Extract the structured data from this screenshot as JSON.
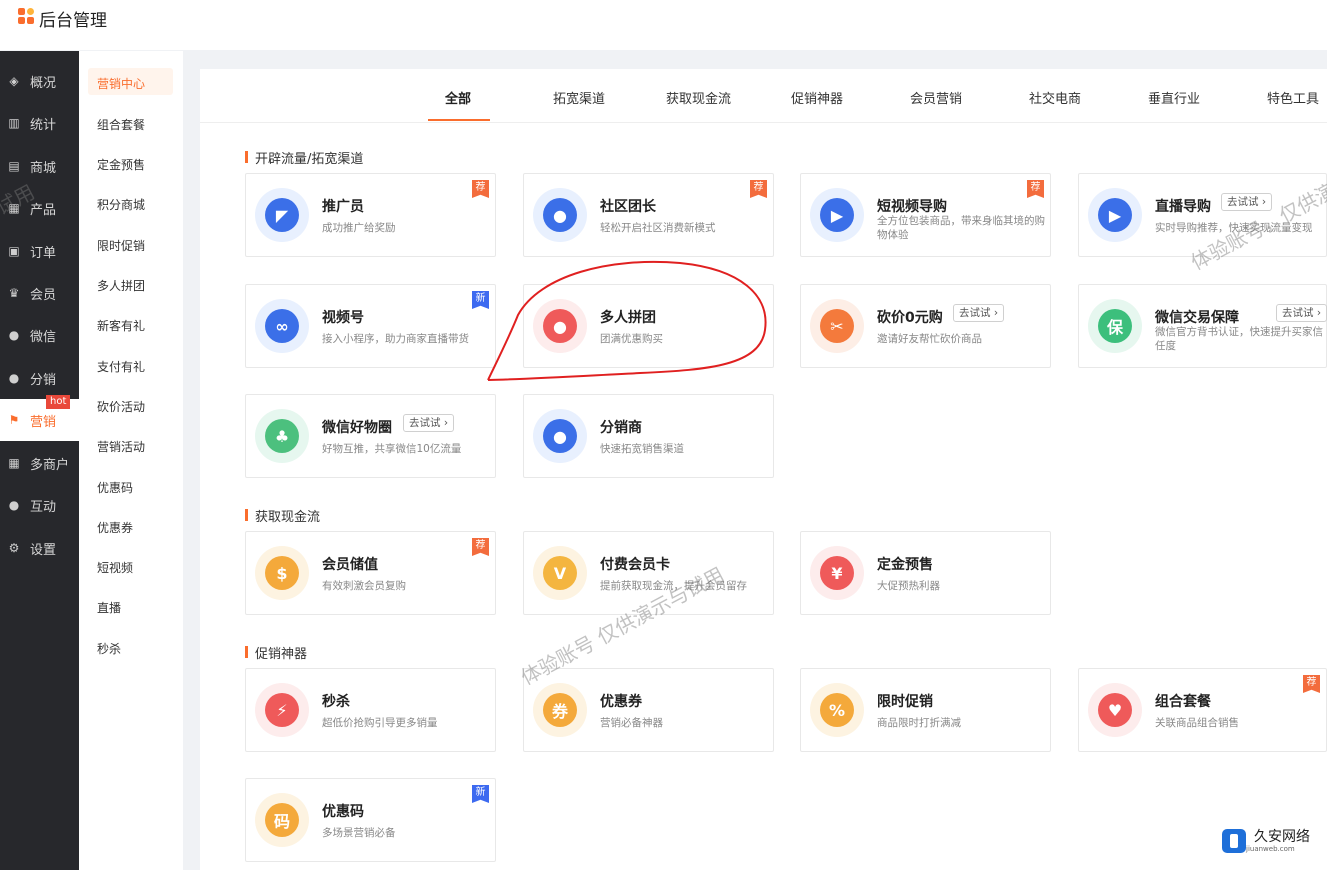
{
  "header": {
    "brand": "后台管理"
  },
  "sidebar": {
    "items": [
      {
        "label": "概况",
        "icon": "layers-icon"
      },
      {
        "label": "统计",
        "icon": "chart-icon"
      },
      {
        "label": "商城",
        "icon": "shop-icon"
      },
      {
        "label": "产品",
        "icon": "grid-icon"
      },
      {
        "label": "订单",
        "icon": "order-icon"
      },
      {
        "label": "会员",
        "icon": "crown-icon"
      },
      {
        "label": "微信",
        "icon": "wechat-icon"
      },
      {
        "label": "分销",
        "icon": "user-icon"
      },
      {
        "label": "营销",
        "icon": "flag-icon",
        "badge": "hot"
      },
      {
        "label": "多商户",
        "icon": "store-icon"
      },
      {
        "label": "互动",
        "icon": "people-icon"
      },
      {
        "label": "设置",
        "icon": "gear-icon"
      }
    ]
  },
  "submenu": {
    "items": [
      "营销中心",
      "组合套餐",
      "定金预售",
      "积分商城",
      "限时促销",
      "多人拼团",
      "新客有礼",
      "支付有礼",
      "砍价活动",
      "营销活动",
      "优惠码",
      "优惠券",
      "短视频",
      "直播",
      "秒杀"
    ]
  },
  "tabs": [
    "全部",
    "拓宽渠道",
    "获取现金流",
    "促销神器",
    "会员营销",
    "社交电商",
    "垂直行业",
    "特色工具"
  ],
  "sections": [
    {
      "title": "开辟流量/拓宽渠道",
      "cards": [
        {
          "name": "推广员",
          "desc": "成功推广给奖励",
          "badge": "荐",
          "color": "#e8f0fe",
          "iconColor": "#3b6fe8",
          "glyph": "◤"
        },
        {
          "name": "社区团长",
          "desc": "轻松开启社区消费新模式",
          "badge": "荐",
          "color": "#e8f0fe",
          "iconColor": "#3b6fe8",
          "glyph": "●"
        },
        {
          "name": "短视频导购",
          "desc": "全方位包装商品，带来身临其境的购物体验",
          "badge": "荐",
          "color": "#e8f0fe",
          "iconColor": "#3b6fe8",
          "glyph": "▶"
        },
        {
          "name": "直播导购",
          "desc": "实时导购推荐，快速实现流量变现",
          "trial": "去试试",
          "color": "#e8f0fe",
          "iconColor": "#3b6fe8",
          "glyph": "▶"
        },
        {
          "name": "视频号",
          "desc": "接入小程序，助力商家直播带货",
          "badge": "新",
          "color": "#e8f0fe",
          "iconColor": "#3b6fe8",
          "glyph": "∞"
        },
        {
          "name": "多人拼团",
          "desc": "团满优惠购买",
          "color": "#fdecec",
          "iconColor": "#ef5a5a",
          "glyph": "●"
        },
        {
          "name": "砍价0元购",
          "desc": "邀请好友帮忙砍价商品",
          "trial": "去试试",
          "color": "#fdeee6",
          "iconColor": "#f47a3c",
          "glyph": "✂"
        },
        {
          "name": "微信交易保障",
          "desc": "微信官方背书认证，快速提升买家信任度",
          "trial": "去试试",
          "color": "#e6f7ef",
          "iconColor": "#3cbf7c",
          "glyph": "保"
        },
        {
          "name": "微信好物圈",
          "desc": "好物互推，共享微信10亿流量",
          "trial": "去试试",
          "color": "#e6f7ef",
          "iconColor": "#4cc07e",
          "glyph": "♣"
        },
        {
          "name": "分销商",
          "desc": "快速拓宽销售渠道",
          "color": "#e8f0fe",
          "iconColor": "#3b6fe8",
          "glyph": "●"
        }
      ]
    },
    {
      "title": "获取现金流",
      "cards": [
        {
          "name": "会员储值",
          "desc": "有效刺激会员复购",
          "badge": "荐",
          "color": "#fdf3e1",
          "iconColor": "#f4a93b",
          "glyph": "$"
        },
        {
          "name": "付费会员卡",
          "desc": "提前获取现金流，提升会员留存",
          "color": "#fdf3e1",
          "iconColor": "#f4b53f",
          "glyph": "V"
        },
        {
          "name": "定金预售",
          "desc": "大促预热利器",
          "color": "#fdecec",
          "iconColor": "#ef5a5a",
          "glyph": "¥"
        }
      ]
    },
    {
      "title": "促销神器",
      "cards": [
        {
          "name": "秒杀",
          "desc": "超低价抢购引导更多销量",
          "color": "#fdecec",
          "iconColor": "#ef5a5a",
          "glyph": "⚡"
        },
        {
          "name": "优惠券",
          "desc": "营销必备神器",
          "color": "#fdf3e1",
          "iconColor": "#f4a93b",
          "glyph": "券"
        },
        {
          "name": "限时促销",
          "desc": "商品限时打折满减",
          "color": "#fdf3e1",
          "iconColor": "#f4a93b",
          "glyph": "%"
        },
        {
          "name": "组合套餐",
          "desc": "关联商品组合销售",
          "badge": "荐",
          "color": "#fdecec",
          "iconColor": "#ef5a5a",
          "glyph": "♥"
        },
        {
          "name": "优惠码",
          "desc": "多场景营销必备",
          "badge": "新",
          "color": "#fdf3e1",
          "iconColor": "#f4a93b",
          "glyph": "码"
        }
      ]
    }
  ],
  "watermarks": [
    "试用",
    "体验账号，仅供演",
    "体验账号 仅供演示与试用"
  ],
  "corner": {
    "name": "久安网络",
    "url": "jiuanweb.com"
  }
}
